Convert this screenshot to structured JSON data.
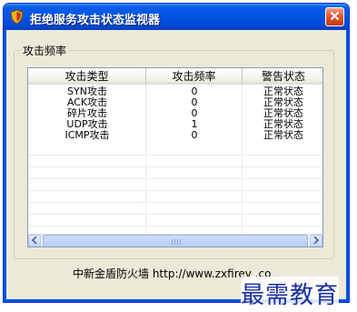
{
  "window": {
    "title": "拒绝服务攻击状态监视器"
  },
  "group": {
    "label": "攻击频率"
  },
  "table": {
    "columns": [
      "攻击类型",
      "攻击频率",
      "警告状态"
    ],
    "rows": [
      [
        "SYN攻击",
        "0",
        "正常状态"
      ],
      [
        "ACK攻击",
        "0",
        "正常状态"
      ],
      [
        "碎片攻击",
        "0",
        "正常状态"
      ],
      [
        "UDP攻击",
        "1",
        "正常状态"
      ],
      [
        "ICMP攻击",
        "0",
        "正常状态"
      ]
    ]
  },
  "footer": {
    "text": "中新金盾防火墙  http://www.zxfirev  .co"
  },
  "watermark": {
    "text": "最需教育"
  },
  "colors": {
    "titlebar": "#0054e3",
    "face": "#ece9d8",
    "close": "#e05a32"
  },
  "icons": {
    "app": "shield-icon",
    "close": "close-icon",
    "left": "arrow-left-icon",
    "right": "arrow-right-icon"
  }
}
